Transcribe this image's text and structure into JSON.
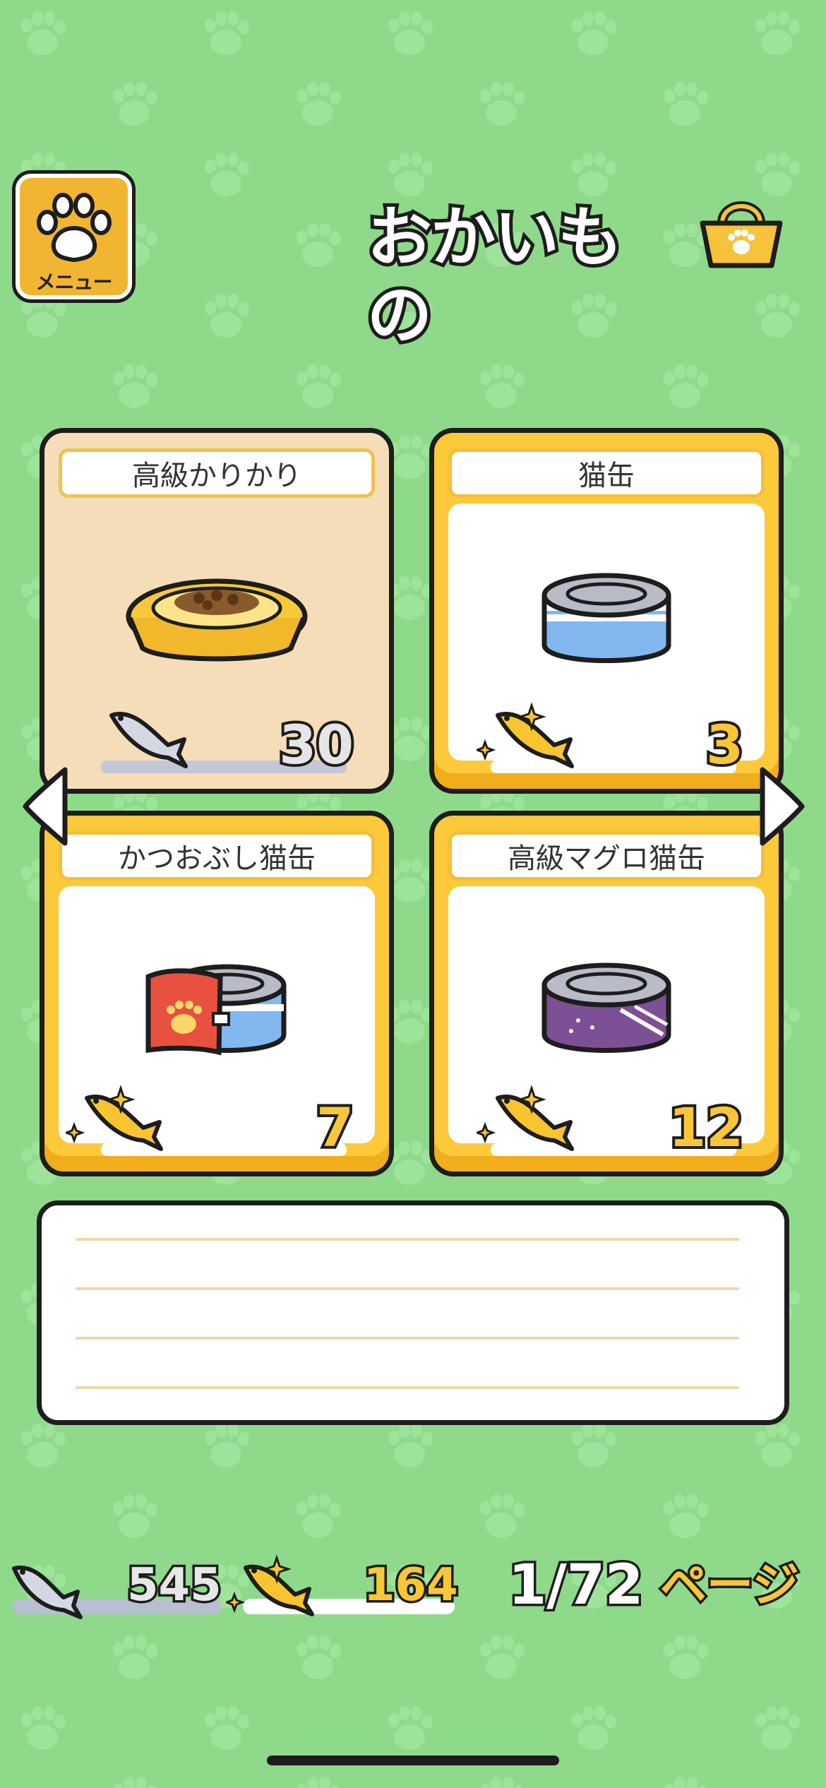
{
  "header": {
    "menu_label": "メニュー",
    "title": "おかいもの"
  },
  "items": [
    {
      "name": "高級かりかり",
      "price": "30",
      "currency": "silver-fish",
      "selected": true,
      "art": "food-bowl"
    },
    {
      "name": "猫缶",
      "price": "3",
      "currency": "gold-fish",
      "selected": false,
      "art": "cat-can-blue"
    },
    {
      "name": "かつおぶし猫缶",
      "price": "7",
      "currency": "gold-fish",
      "selected": false,
      "art": "bonito-can"
    },
    {
      "name": "高級マグロ猫缶",
      "price": "12",
      "currency": "gold-fish",
      "selected": false,
      "art": "tuna-can-purple"
    }
  ],
  "description": {
    "text": ""
  },
  "footer": {
    "silver_fish_count": "545",
    "gold_fish_count": "164",
    "page_number": "1/72",
    "page_label": "ページ"
  },
  "colors": {
    "background": "#8fd98b",
    "accent_gold": "#fcc93b",
    "selected_card": "#f4ddb8",
    "outline": "#1d1d1d"
  }
}
